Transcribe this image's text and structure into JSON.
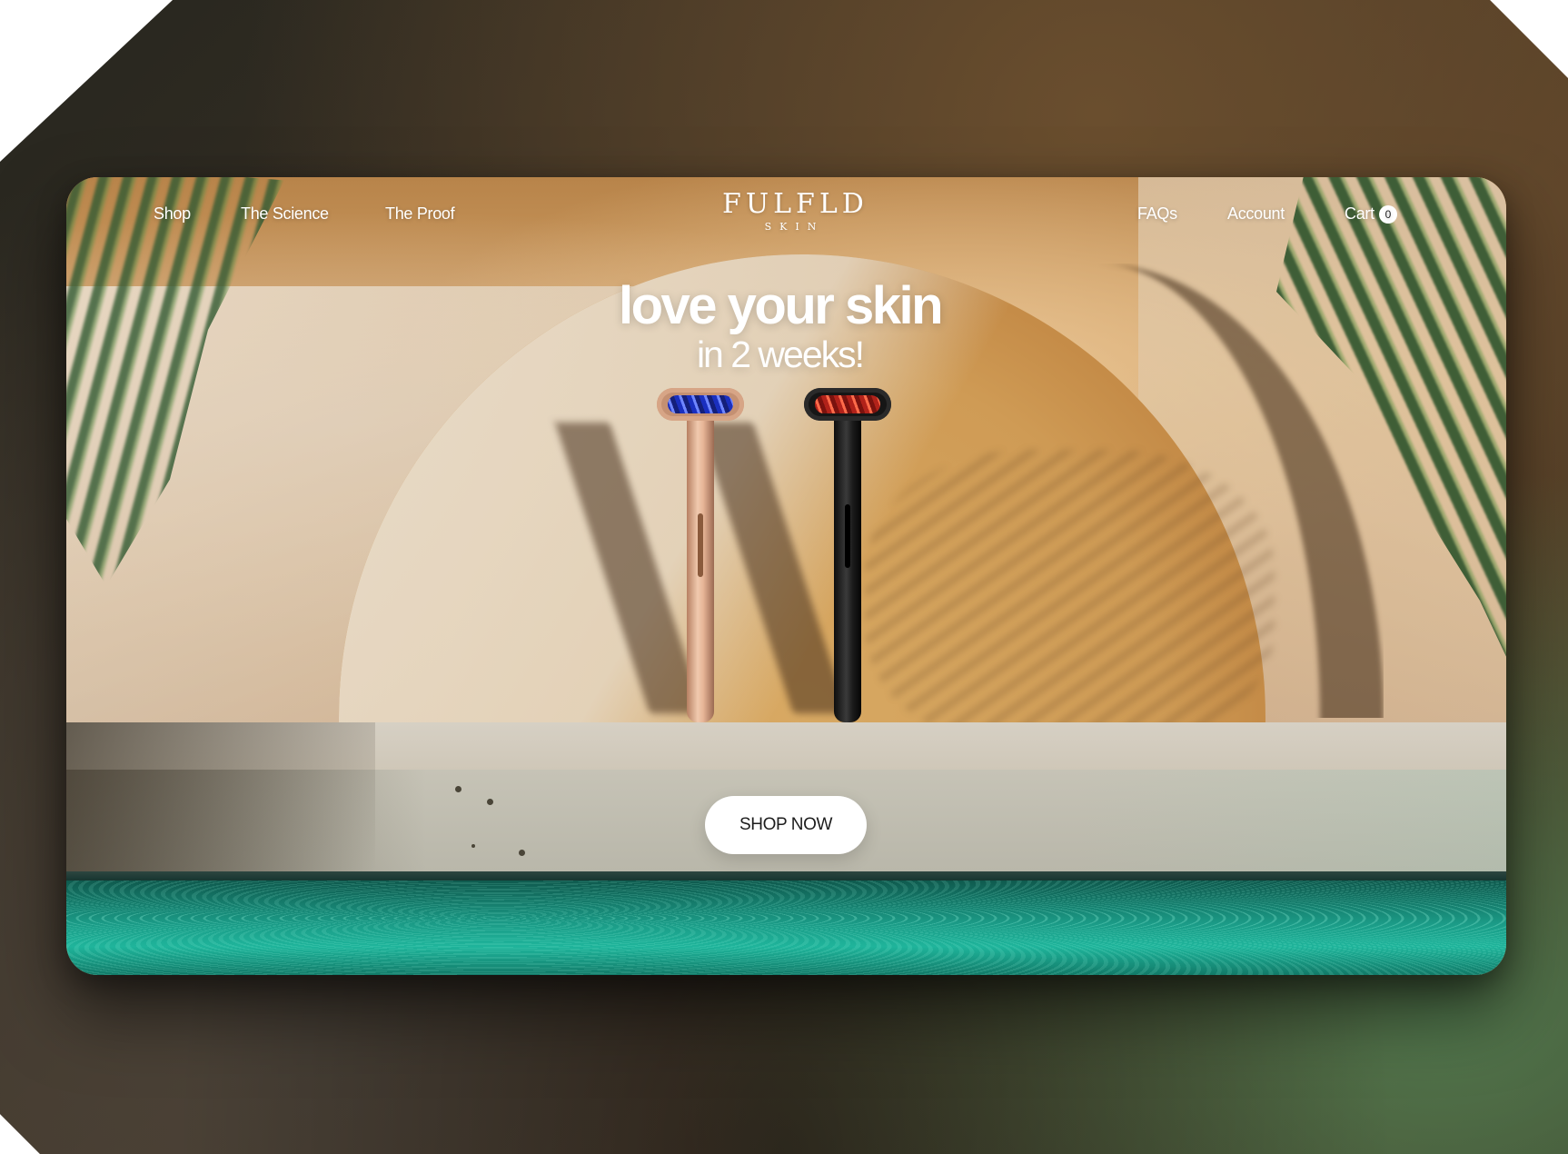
{
  "nav": {
    "left_links": [
      {
        "label": "Shop"
      },
      {
        "label": "The Science"
      },
      {
        "label": "The Proof"
      }
    ],
    "logo": {
      "main": "FULFLD",
      "sub": "SKIN"
    },
    "right_links": [
      {
        "label": "FAQs"
      },
      {
        "label": "Account"
      },
      {
        "label": "Cart"
      }
    ],
    "cart_count": "0"
  },
  "hero": {
    "headline": "love your skin",
    "subheadline": "in 2 weeks!",
    "cta_label": "SHOP NOW"
  },
  "colors": {
    "cta_background": "#ffffff",
    "cta_text": "#1d1d1d",
    "nav_text": "#ffffff",
    "water": "#1fb49b"
  }
}
